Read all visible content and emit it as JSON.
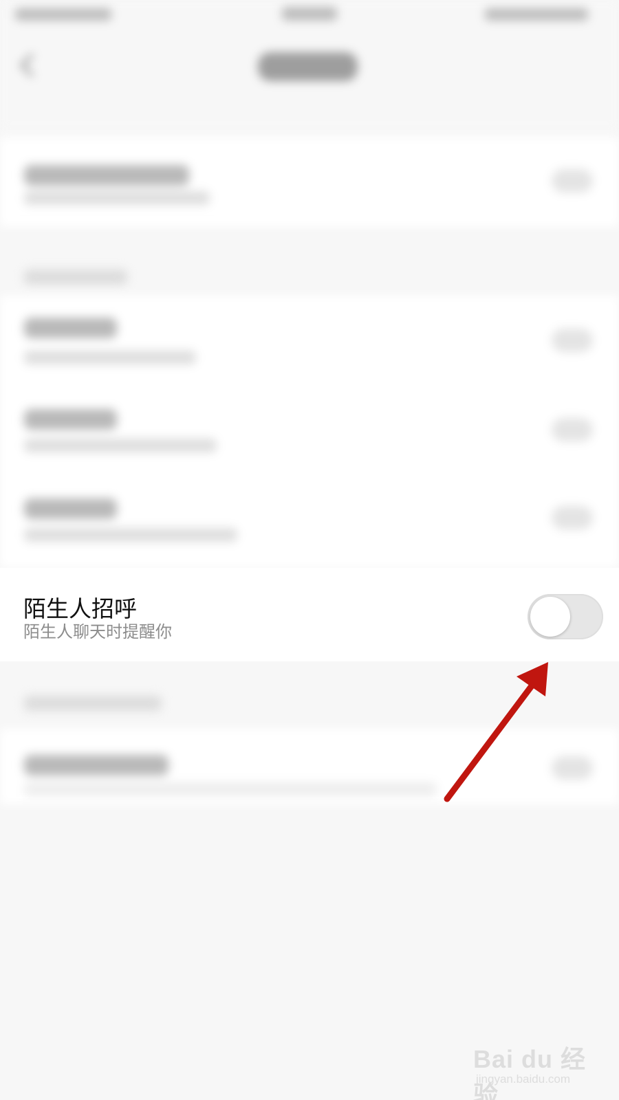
{
  "stranger_greeting": {
    "title": "陌生人招呼",
    "subtitle": "陌生人聊天时提醒你",
    "toggle_on": false
  },
  "annotation": {
    "color": "#c0160f",
    "icon": "red-arrow-icon"
  },
  "watermark": {
    "brand": "Bai du 经验",
    "url": "jingyan.baidu.com"
  }
}
